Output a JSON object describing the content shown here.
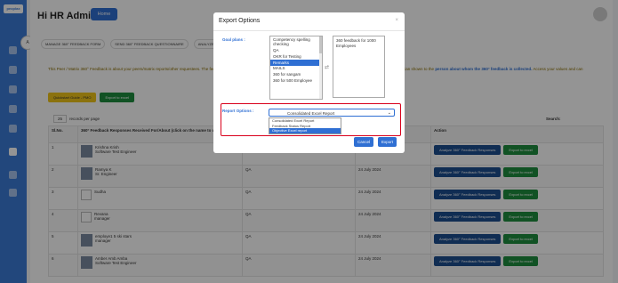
{
  "sidebar": {
    "logo": "peoplax",
    "collapse_label": "A"
  },
  "header": {
    "title": "Hi HR Admin",
    "home_label": "Home"
  },
  "tabs": [
    "MANAGE 360° FEEDBACK FORM",
    "SEND 360° FEEDBACK QUESTIONNAIRE",
    "ANALYZE"
  ],
  "info": {
    "text": "This Peer / Matrix 360° Feedback is about your peers/matrix reports/other requestees. The feedback is given by the 360° Feedback provider, the 360° feedback requester and HRD/PMD/DH admin and can shown to the",
    "bold": "person about whom the 360° feedback is collected.",
    "tail": " Access your values and can"
  },
  "buttons": {
    "guide": "Quickstart Guide - PMO",
    "export": "Export to excel"
  },
  "table": {
    "per_page_value": "25",
    "per_page_label": "records per page",
    "search_label": "Search:",
    "headers": [
      "Sl.No.",
      "360° Feedback Responses Received For/About (click on the name to view profile)",
      "",
      "",
      "Action"
    ],
    "analyze_label": "Analyze 360° Feedback Responses",
    "export_label": "Export to excel",
    "rows": [
      {
        "no": "1",
        "name": "Krishna Krish",
        "role": "Software Test Engineer",
        "team": "",
        "date": "",
        "photo": "photo"
      },
      {
        "no": "2",
        "name": "Ramya K",
        "role": "Sr. Engineer",
        "team": "QA",
        "date": "24 July 2024",
        "photo": "photo"
      },
      {
        "no": "3",
        "name": "",
        "role": "Sudha",
        "team": "QA",
        "date": "24 July 2024",
        "photo": "broken"
      },
      {
        "no": "4",
        "name": "Revana",
        "role": "manager",
        "team": "QA",
        "date": "24 July 2024",
        "photo": "broken"
      },
      {
        "no": "5",
        "name": "employe1 5 ski stars",
        "role": "manager",
        "team": "QA",
        "date": "24 July 2024",
        "photo": "photo"
      },
      {
        "no": "6",
        "name": "Amber Amb Amba",
        "role": "Software Test Engineer",
        "team": "QA",
        "date": "24 July 2024",
        "photo": "photo"
      }
    ]
  },
  "modal": {
    "title": "Export Options",
    "close": "×",
    "goal_label": "Goal plans :",
    "goal_options": [
      "Competency spelling checking",
      "QA",
      "OKR for Testing",
      "Remarks",
      "MAILS",
      "360 for sangam",
      "360 for 500 Employee"
    ],
    "selected_goal": "Remarks",
    "arrow": "⇄",
    "target_items": [
      "360 feedback for 1000 Employees"
    ],
    "report_label": "Report Options :",
    "report_value": "Consolidated Excel Report",
    "report_options": [
      "Consolidated Excel Report",
      "Feedback Status Report",
      "Objective Excel report"
    ],
    "selected_report": "Objective Excel report",
    "cancel": "Cancel",
    "export": "Export"
  },
  "colors": {
    "primary": "#2f6fd3",
    "highlight": "#d9001b"
  }
}
